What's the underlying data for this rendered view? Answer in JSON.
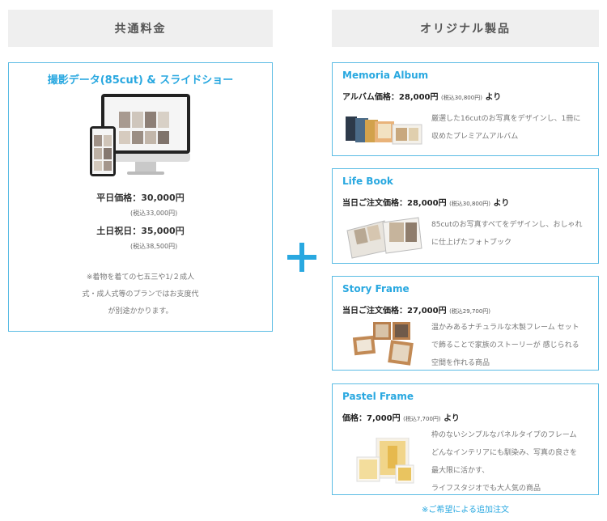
{
  "headers": {
    "common_fee": "共通料金",
    "original_products": "オリジナル製品"
  },
  "main_plan": {
    "title": "撮影データ(85cut) & スライドショー",
    "weekday_price": "平日価格：30,000円",
    "weekday_tax": "(税込33,000円)",
    "holiday_price": "土日祝日：35,000円",
    "holiday_tax": "(税込38,500円)",
    "note_lines": [
      "※着物を着ての七五三や1/２成人",
      "式・成人式等のプランではお支度代",
      "が別途かかります。"
    ]
  },
  "products": [
    {
      "title": "Memoria Album",
      "price_label": "アルバム価格：28,000円",
      "price_tax": "(税込30,800円)",
      "price_suffix": "より",
      "desc_lines": [
        "厳選した16cutのお写真をデザインし、1冊に",
        "収めたプレミアムアルバム"
      ]
    },
    {
      "title": "Life Book",
      "price_label": "当日ご注文価格：28,000円",
      "price_tax": "(税込30,800円)",
      "price_suffix": "より",
      "desc_lines": [
        "85cutのお写真すべてをデザインし、おしゃれ",
        "に仕上げたフォトブック"
      ]
    },
    {
      "title": "Story Frame",
      "price_label": "当日ご注文価格：27,000円",
      "price_tax": "(税込29,700円)",
      "price_suffix": "",
      "desc_lines": [
        "温かみあるナチュラルな木製フレーム セット",
        "で飾ることで家族のストーリーが 感じられる",
        "空間を作れる商品"
      ]
    },
    {
      "title": "Pastel Frame",
      "price_label": "価格：7,000円",
      "price_tax": "(税込7,700円)",
      "price_suffix": "より",
      "desc_lines": [
        "枠のないシンプルなパネルタイプのフレーム",
        "どんなインテリアにも馴染み、写真の良さを",
        "最大限に活かす、",
        "ライフスタジオでも大人気の商品"
      ]
    }
  ],
  "footer_note": "※ご希望による追加注文"
}
